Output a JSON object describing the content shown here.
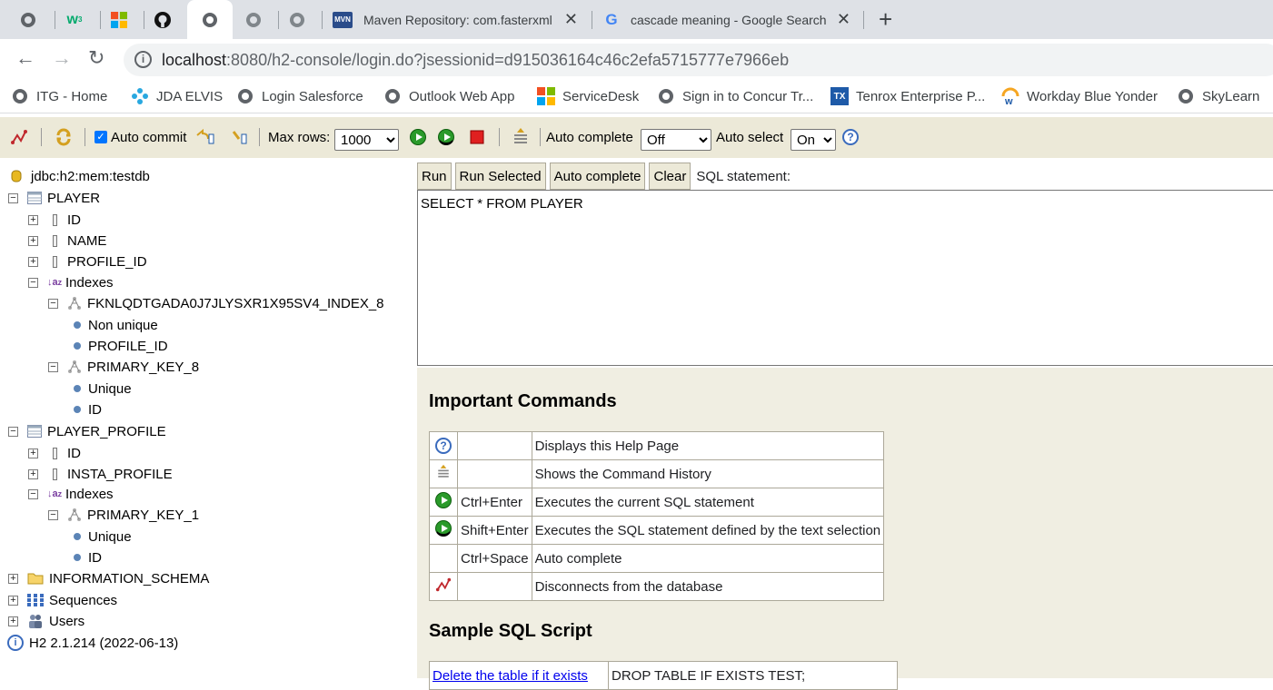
{
  "browser": {
    "tabs": [
      {
        "icon": "globe-icon",
        "title": ""
      },
      {
        "icon": "w3schools-icon",
        "title": ""
      },
      {
        "icon": "windows-icon",
        "title": ""
      },
      {
        "icon": "github-icon",
        "title": ""
      },
      {
        "icon": "globe-icon",
        "title": "",
        "active": true
      },
      {
        "icon": "globe-icon",
        "title": ""
      },
      {
        "icon": "globe-icon",
        "title": ""
      },
      {
        "icon": "mvn-icon",
        "title": "Maven Repository: com.fasterxml"
      },
      {
        "icon": "google-icon",
        "title": "cascade meaning - Google Search"
      }
    ],
    "url_host": "localhost",
    "url_rest": ":8080/h2-console/login.do?jsessionid=d915036164c46c2efa5715777e7966eb",
    "bookmarks": [
      {
        "icon": "globe-icon",
        "label": "ITG - Home"
      },
      {
        "icon": "jda-icon",
        "label": "JDA ELVIS"
      },
      {
        "icon": "globe-icon",
        "label": "Login  Salesforce"
      },
      {
        "icon": "globe-icon",
        "label": "Outlook Web App"
      },
      {
        "icon": "windows-icon",
        "label": "ServiceDesk"
      },
      {
        "icon": "globe-icon",
        "label": "Sign in to Concur Tr..."
      },
      {
        "icon": "tenrox-icon",
        "label": "Tenrox Enterprise P..."
      },
      {
        "icon": "workday-icon",
        "label": "Workday Blue Yonder"
      },
      {
        "icon": "globe-icon",
        "label": "SkyLearn"
      }
    ]
  },
  "toolbar": {
    "auto_commit_label": "Auto commit",
    "max_rows_label": "Max rows:",
    "max_rows_value": "1000",
    "auto_complete_label": "Auto complete",
    "auto_complete_value": "Off",
    "auto_select_label": "Auto select",
    "auto_select_value": "On"
  },
  "tree": {
    "connection": "jdbc:h2:mem:testdb",
    "player": "PLAYER",
    "player_cols": [
      "ID",
      "NAME",
      "PROFILE_ID"
    ],
    "indexes": "Indexes",
    "fk_index": "FKNLQDTGADA0J7JLYSXR1X95SV4_INDEX_8",
    "fk_props": [
      "Non unique",
      "PROFILE_ID"
    ],
    "pk8": "PRIMARY_KEY_8",
    "pk8_props": [
      "Unique",
      "ID"
    ],
    "player_profile": "PLAYER_PROFILE",
    "profile_cols": [
      "ID",
      "INSTA_PROFILE"
    ],
    "pk1": "PRIMARY_KEY_1",
    "pk1_props": [
      "Unique",
      "ID"
    ],
    "info_schema": "INFORMATION_SCHEMA",
    "sequences": "Sequences",
    "users": "Users",
    "version": "H2 2.1.214 (2022-06-13)"
  },
  "query": {
    "run": "Run",
    "run_selected": "Run Selected",
    "auto_complete": "Auto complete",
    "clear": "Clear",
    "sql_label": "SQL statement:",
    "sql": "SELECT * FROM PLAYER"
  },
  "help": {
    "important_title": "Important Commands",
    "commands": [
      {
        "icon": "help-icon",
        "key": "",
        "desc": "Displays this Help Page"
      },
      {
        "icon": "history-icon",
        "key": "",
        "desc": "Shows the Command History"
      },
      {
        "icon": "run-icon",
        "key": "Ctrl+Enter",
        "desc": "Executes the current SQL statement"
      },
      {
        "icon": "run-selected-icon",
        "key": "Shift+Enter",
        "desc": "Executes the SQL statement defined by the text selection"
      },
      {
        "icon": "",
        "key": "Ctrl+Space",
        "desc": "Auto complete"
      },
      {
        "icon": "disconnect-icon",
        "key": "",
        "desc": "Disconnects from the database"
      }
    ],
    "sample_title": "Sample SQL Script",
    "sample_link": "Delete the table if it exists",
    "sample_sql": "DROP TABLE IF EXISTS TEST;"
  }
}
